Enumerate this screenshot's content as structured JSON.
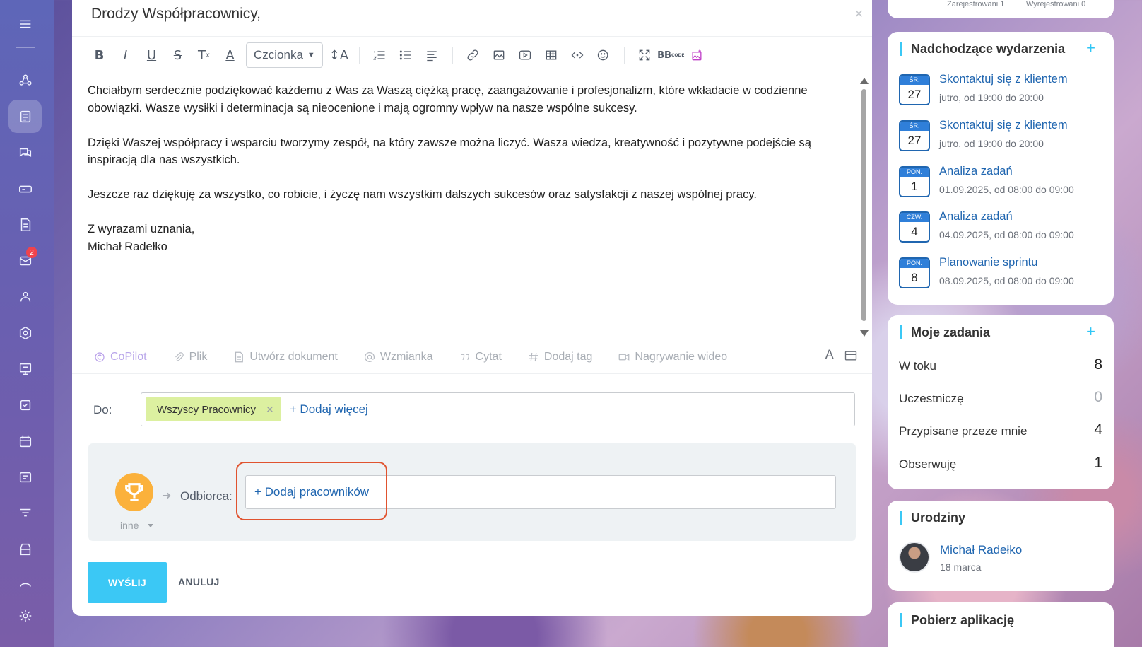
{
  "editor": {
    "title": "Drodzy Współpracownicy,",
    "font_select": "Czcionka",
    "toolbar_icons": [
      "bold",
      "italic",
      "underline",
      "strikethrough",
      "clear-format",
      "text-color",
      "font-size",
      "numbered-list",
      "bulleted-list",
      "align",
      "link",
      "image",
      "video",
      "table",
      "code",
      "emoji",
      "fullscreen",
      "bb-code",
      "copilot-image"
    ],
    "paragraphs": [
      "Chciałbym serdecznie podziękować każdemu z Was za Waszą ciężką pracę, zaangażowanie i profesjonalizm, które wkładacie w codzienne obowiązki. Wasze wysiłki i determinacja są nieocenione i mają ogromny wpływ na nasze wspólne sukcesy.",
      "Dzięki Waszej współpracy i wsparciu tworzymy zespół, na który zawsze można liczyć. Wasza wiedza, kreatywność i pozytywne podejście są inspiracją dla nas wszystkich.",
      "Jeszcze raz dziękuję za wszystko, co robicie, i życzę nam wszystkim dalszych sukcesów oraz satysfakcji z naszej wspólnej pracy."
    ],
    "signoff_line1": "Z wyrazami uznania,",
    "signoff_line2": "Michał Radełko",
    "actions": {
      "copilot": "CoPilot",
      "file": "Plik",
      "create_doc": "Utwórz dokument",
      "mention": "Wzmianka",
      "quote": "Cytat",
      "add_tag": "Dodaj tag",
      "video": "Nagrywanie wideo",
      "format_letter": "A"
    },
    "to_label": "Do:",
    "to_chip": "Wszyscy Pracownicy",
    "add_more": "+ Dodaj więcej",
    "badge_category": "inne",
    "recipient_label": "Odbiorca:",
    "add_employees": "+ Dodaj pracowników",
    "send": "WYŚLIJ",
    "cancel": "ANULUJ"
  },
  "rail": {
    "mail_badge": "2"
  },
  "top_stub": {
    "left": "Zarejestrowani 1",
    "right": "Wyrejestrowani 0"
  },
  "events": {
    "title": "Nadchodzące wydarzenia",
    "items": [
      {
        "weekday": "ŚR.",
        "day": "27",
        "title": "Skontaktuj się z klientem",
        "time": "jutro, od 19:00 do 20:00"
      },
      {
        "weekday": "ŚR.",
        "day": "27",
        "title": "Skontaktuj się z klientem",
        "time": "jutro, od 19:00 do 20:00"
      },
      {
        "weekday": "PON.",
        "day": "1",
        "title": "Analiza zadań",
        "time": "01.09.2025, od 08:00 do 09:00"
      },
      {
        "weekday": "CZW.",
        "day": "4",
        "title": "Analiza zadań",
        "time": "04.09.2025, od 08:00 do 09:00"
      },
      {
        "weekday": "PON.",
        "day": "8",
        "title": "Planowanie sprintu",
        "time": "08.09.2025, od 08:00 do 09:00"
      }
    ]
  },
  "tasks": {
    "title": "Moje zadania",
    "rows": [
      {
        "label": "W toku",
        "count": "8"
      },
      {
        "label": "Uczestniczę",
        "count": "0"
      },
      {
        "label": "Przypisane przeze mnie",
        "count": "4"
      },
      {
        "label": "Obserwuję",
        "count": "1"
      }
    ]
  },
  "birthdays": {
    "title": "Urodziny",
    "name": "Michał Radełko",
    "date": "18 marca"
  },
  "apps": {
    "title": "Pobierz aplikację"
  },
  "colors": {
    "accent": "#3bc8f5",
    "link": "#2066b0",
    "chip": "#dcf0a0",
    "highlight": "#e0532f",
    "trophy": "#fbb13b"
  }
}
